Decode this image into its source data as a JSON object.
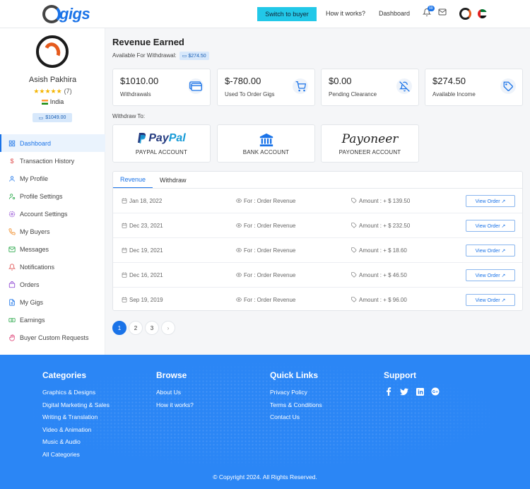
{
  "header": {
    "brand": "gigs",
    "switch_label": "Switch to buyer",
    "how_label": "How it works?",
    "dashboard_label": "Dashboard",
    "notif_count": "99"
  },
  "profile": {
    "name": "Asish Pakhira",
    "stars": "★★★★★",
    "rating_count": "(7)",
    "country": "India",
    "balance": "$1049.00"
  },
  "menu": [
    {
      "label": "Dashboard",
      "icon": "grid-icon"
    },
    {
      "label": "Transaction History",
      "icon": "dollar-icon"
    },
    {
      "label": "My Profile",
      "icon": "user-icon"
    },
    {
      "label": "Profile Settings",
      "icon": "user-gear-icon"
    },
    {
      "label": "Account Settings",
      "icon": "gear-icon"
    },
    {
      "label": "My Buyers",
      "icon": "phone-icon"
    },
    {
      "label": "Messages",
      "icon": "mail-icon"
    },
    {
      "label": "Notifications",
      "icon": "bell-icon"
    },
    {
      "label": "Orders",
      "icon": "bag-icon"
    },
    {
      "label": "My Gigs",
      "icon": "document-icon"
    },
    {
      "label": "Earnings",
      "icon": "cash-icon"
    },
    {
      "label": "Buyer Custom Requests",
      "icon": "hand-icon"
    }
  ],
  "main": {
    "title": "Revenue Earned",
    "available_label": "Available For Withdrawal:",
    "available_value": "$274.50",
    "stats": [
      {
        "value": "$1010.00",
        "label": "Withdrawals",
        "icon": "card-icon"
      },
      {
        "value": "$-780.00",
        "label": "Used To Order Gigs",
        "icon": "cart-icon"
      },
      {
        "value": "$0.00",
        "label": "Pending Clearance",
        "icon": "bell-off-icon"
      },
      {
        "value": "$274.50",
        "label": "Available Income",
        "icon": "tag-icon"
      }
    ],
    "withdraw_to": "Withdraw To:",
    "methods": [
      {
        "name": "PAYPAL ACCOUNT",
        "logo_a": "Pay",
        "logo_b": "Pal"
      },
      {
        "name": "BANK ACCOUNT"
      },
      {
        "name": "PAYONEER ACCOUNT",
        "logo": "Payoneer"
      }
    ],
    "tabs": [
      "Revenue",
      "Withdraw"
    ],
    "transactions": [
      {
        "date": "Jan 18, 2022",
        "for": "For : Order Revenue",
        "amount": "Amount : + $ 139.50",
        "action": "View Order ↗"
      },
      {
        "date": "Dec 23, 2021",
        "for": "For : Order Revenue",
        "amount": "Amount : + $ 232.50",
        "action": "View Order ↗"
      },
      {
        "date": "Dec 19, 2021",
        "for": "For : Order Revenue",
        "amount": "Amount : + $ 18.60",
        "action": "View Order ↗"
      },
      {
        "date": "Dec 16, 2021",
        "for": "For : Order Revenue",
        "amount": "Amount : + $ 46.50",
        "action": "View Order ↗"
      },
      {
        "date": "Sep 19, 2019",
        "for": "For : Order Revenue",
        "amount": "Amount : + $ 96.00",
        "action": "View Order ↗"
      }
    ],
    "pages": [
      "1",
      "2",
      "3",
      "›"
    ]
  },
  "footer": {
    "categories": {
      "title": "Categories",
      "links": [
        "Graphics & Designs",
        "Digital Marketing & Sales",
        "Writing & Translation",
        "Video & Animation",
        "Music & Audio",
        "All Categories"
      ]
    },
    "browse": {
      "title": "Browse",
      "links": [
        "About Us",
        "How it works?"
      ]
    },
    "quick": {
      "title": "Quick Links",
      "links": [
        "Privacy Policy",
        "Terms & Conditions",
        "Contact Us"
      ]
    },
    "support": {
      "title": "Support"
    },
    "copyright": "© Copyright 2024. All Rights Reserved."
  },
  "colors": {
    "accent": "#1a73e8",
    "footer": "#2b86f5",
    "switch": "#22c8e8"
  }
}
